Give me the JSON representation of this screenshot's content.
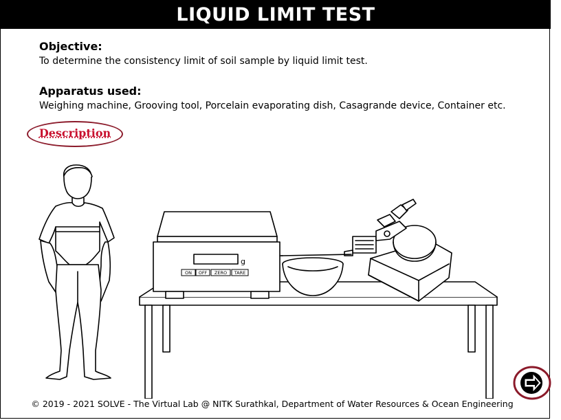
{
  "header": {
    "title": "LIQUID LIMIT TEST"
  },
  "objective": {
    "heading": "Objective:",
    "text": "To determine the consistency limit of soil sample by liquid limit test."
  },
  "apparatus": {
    "heading": "Apparatus used:",
    "text": "Weighing machine, Grooving tool, Porcelain evaporating dish, Casagrande device, Container etc."
  },
  "description_link": "Description",
  "scale": {
    "unit": "g",
    "buttons": [
      "ON",
      "OFF",
      "ZERO",
      "TARE"
    ]
  },
  "footer": {
    "text": "© 2019 - 2021 SOLVE - The Virtual Lab @ NITK Surathkal, Department of Water Resources & Ocean Engineering"
  },
  "icons": {
    "next": "next-arrow-icon"
  },
  "colors": {
    "title_bar": "#000000",
    "description_text": "#c8102e",
    "description_border": "#8b1a2a",
    "next_button_ring": "#8b1a2a"
  }
}
